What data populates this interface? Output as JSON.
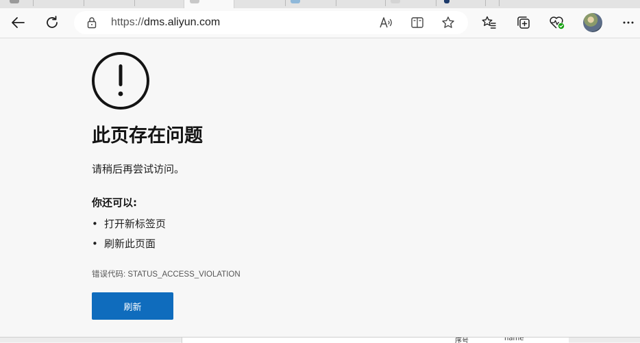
{
  "browser": {
    "address_bar": {
      "url_scheme": "https://",
      "url_host": "dms.aliyun.com",
      "read_aloud_icon": "read-aloud-icon",
      "reading_view_icon": "reading-view-icon",
      "favorite_icon": "star-icon"
    },
    "toolbar_icons": [
      "back-arrow-icon",
      "reload-icon",
      "favorites-icon",
      "collections-icon",
      "browser-essentials-icon",
      "more-icon"
    ]
  },
  "error_page": {
    "title": "此页存在问题",
    "description": "请稍后再尝试访问。",
    "suggestions_heading": "你还可以:",
    "suggestions": [
      "打开新标签页",
      "刷新此页面"
    ],
    "error_code": "错误代码: STATUS_ACCESS_VIOLATION",
    "refresh_button": "刷新",
    "accent_color": "#0f6cbd"
  },
  "background_window": {
    "col1": "序号",
    "col2": "name"
  }
}
